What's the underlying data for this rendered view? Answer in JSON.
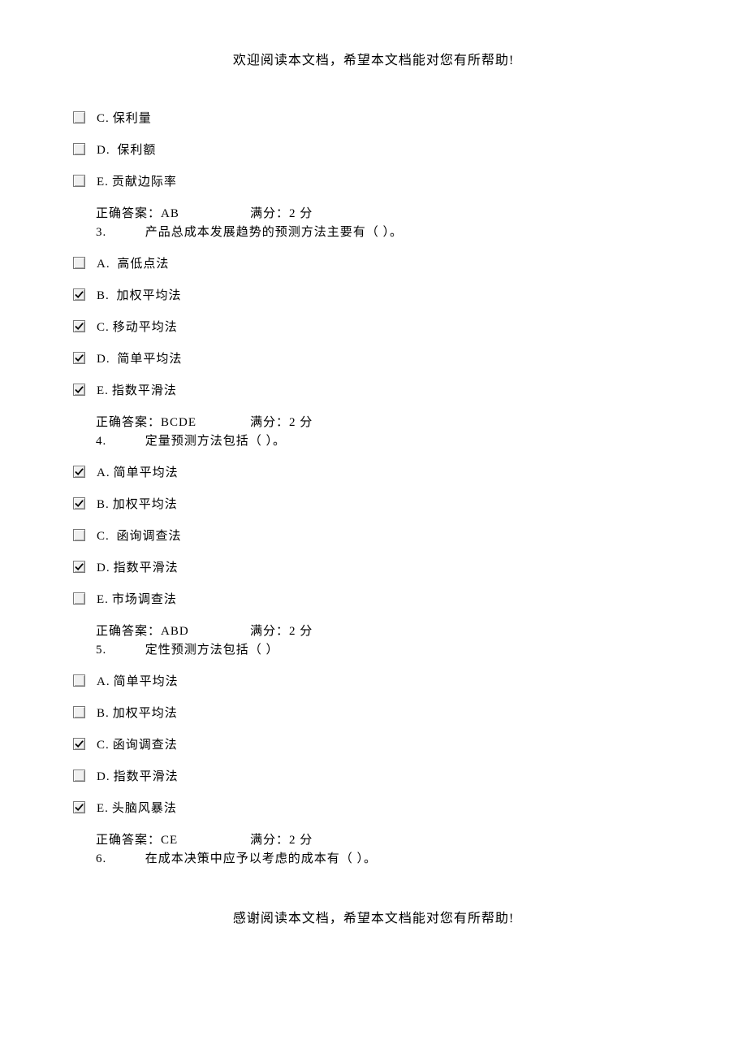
{
  "header": "欢迎阅读本文档，希望本文档能对您有所帮助!",
  "footer": "感谢阅读本文档，希望本文档能对您有所帮助!",
  "top_options": [
    {
      "letter": "C.",
      "text": "保利量",
      "checked": false
    },
    {
      "letter": "D.",
      "text": "  保利额",
      "checked": false
    },
    {
      "letter": "E.",
      "text": "贡献边际率",
      "checked": false
    }
  ],
  "q2_answer_prefix": "正确答案：",
  "q2_answer": "AB",
  "q2_score": "满分：2    分",
  "q3_num": "3.",
  "q3_text": "  产品总成本发展趋势的预测方法主要有（      ）。",
  "q3_options": [
    {
      "letter": "A.",
      "text": "  高低点法",
      "checked": false
    },
    {
      "letter": "B.",
      "text": "  加权平均法",
      "checked": true
    },
    {
      "letter": "C.",
      "text": "移动平均法",
      "checked": true
    },
    {
      "letter": "D.",
      "text": "  简单平均法",
      "checked": true
    },
    {
      "letter": "E.",
      "text": "指数平滑法",
      "checked": true
    }
  ],
  "q3_answer": "BCDE",
  "q3_score": "满分：2    分",
  "q4_num": "4.",
  "q4_text": "  定量预测方法包括（      ）。",
  "q4_options": [
    {
      "letter": "A.",
      "text": "简单平均法",
      "checked": true
    },
    {
      "letter": "B.",
      "text": "加权平均法",
      "checked": true
    },
    {
      "letter": "C.",
      "text": "  函询调查法",
      "checked": false
    },
    {
      "letter": "D.",
      "text": "指数平滑法",
      "checked": true
    },
    {
      "letter": "E.",
      "text": "市场调查法",
      "checked": false
    }
  ],
  "q4_answer": "ABD",
  "q4_score": "满分：2    分",
  "q5_num": "5.",
  "q5_text": "  定性预测方法包括（      ）",
  "q5_options": [
    {
      "letter": "A.",
      "text": "简单平均法",
      "checked": false
    },
    {
      "letter": "B.",
      "text": "加权平均法",
      "checked": false
    },
    {
      "letter": "C.",
      "text": "函询调查法",
      "checked": true
    },
    {
      "letter": "D.",
      "text": "指数平滑法",
      "checked": false
    },
    {
      "letter": "E.",
      "text": "头脑风暴法",
      "checked": true
    }
  ],
  "q5_answer": "CE",
  "q5_score": "满分：2    分",
  "q6_num": "6.",
  "q6_text": "  在成本决策中应予以考虑的成本有（      ）。"
}
